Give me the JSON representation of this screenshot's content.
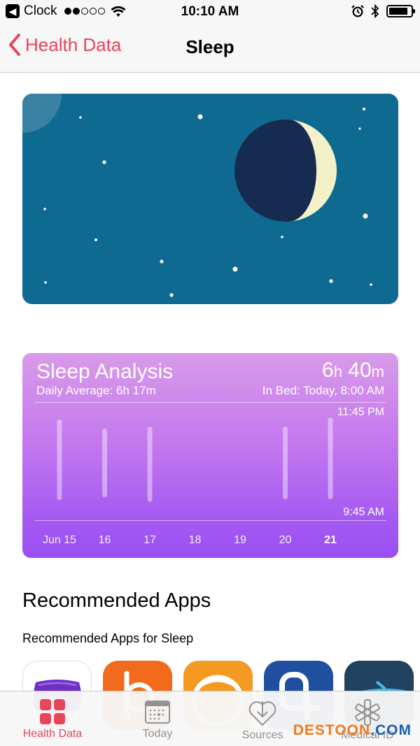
{
  "status_bar": {
    "back_app": "Clock",
    "time": "10:10 AM",
    "signal_bars_filled": 2,
    "signal_bars_total": 5
  },
  "nav": {
    "back_label": "Health Data",
    "title": "Sleep"
  },
  "sleep_analysis": {
    "title": "Sleep Analysis",
    "daily_average": "Daily Average: 6h 17m",
    "total_hours": "6",
    "total_hours_unit": "h",
    "total_minutes": "40",
    "total_minutes_unit": "m",
    "in_bed": "In Bed: Today, 8:00 AM",
    "time_top": "11:45 PM",
    "time_bottom": "9:45 AM",
    "days": [
      "Jun 15",
      "16",
      "17",
      "18",
      "19",
      "20",
      "21"
    ],
    "active_day_index": 6
  },
  "chart_data": {
    "type": "bar",
    "categories": [
      "Jun 15",
      "16",
      "17",
      "18",
      "19",
      "20",
      "21"
    ],
    "y_axis": {
      "top": "11:45 PM",
      "bottom": "9:45 AM"
    },
    "series": [
      {
        "values": [
          {
            "start": 0.04,
            "end": 0.94
          },
          {
            "start": 0.14,
            "end": 0.91
          },
          {
            "start": 0.12,
            "end": 0.96
          },
          null,
          null,
          {
            "start": 0.12,
            "end": 0.93
          },
          {
            "start": 0.02,
            "end": 0.93
          }
        ]
      }
    ]
  },
  "recommended": {
    "title": "Recommended Apps",
    "subtitle": "Recommended Apps for Sleep"
  },
  "tabs": [
    {
      "label": "Health Data",
      "icon": "grid-icon",
      "active": true
    },
    {
      "label": "Today",
      "icon": "calendar-icon",
      "active": false
    },
    {
      "label": "Sources",
      "icon": "download-heart-icon",
      "active": false
    },
    {
      "label": "Medical ID",
      "icon": "asterisk-icon",
      "active": false
    }
  ],
  "watermark": {
    "prefix": "DESTOON",
    "suffix": ".COM"
  },
  "colors": {
    "accent": "#e8455a",
    "hero_background": "#0f6a92",
    "moon_dark": "#162b50",
    "moon_light": "#f3f1c8",
    "card_gradient_top": "#d89be9",
    "card_gradient_bottom": "#9a4ff4"
  }
}
